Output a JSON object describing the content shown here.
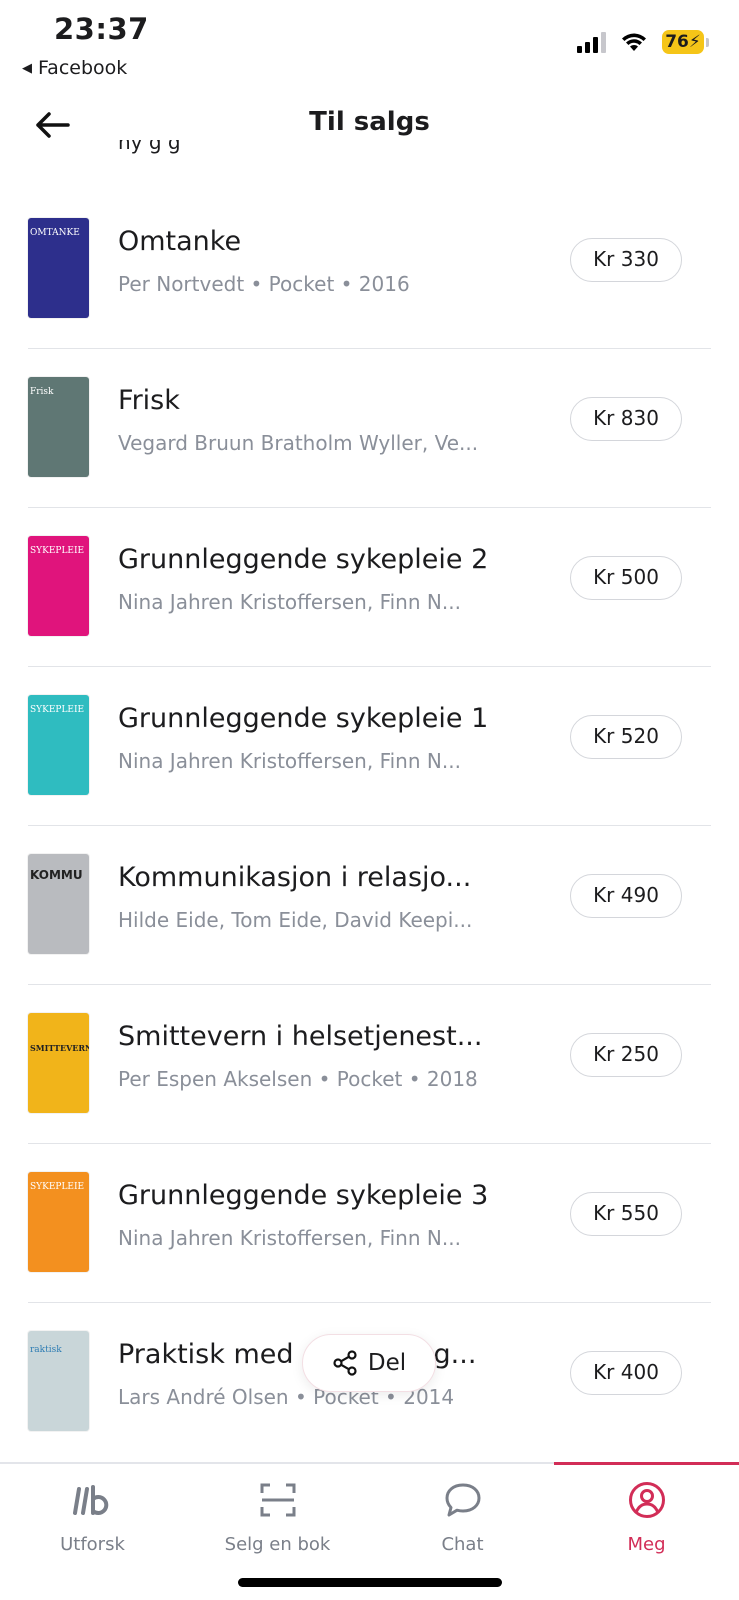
{
  "status_bar": {
    "time": "23:37",
    "back_app": "Facebook",
    "battery": "76"
  },
  "header": {
    "title": "Til salgs",
    "clipped_text": "ny g g"
  },
  "books": [
    {
      "title": "Omtanke",
      "subtitle": "Per Nortvedt • Pocket • 2016",
      "price": "Kr 330",
      "cover_color": "#2d2f8c",
      "cover_text": "OMTANKE"
    },
    {
      "title": "Frisk",
      "subtitle": "Vegard Bruun Bratholm Wyller, Ve...",
      "price": "Kr 830",
      "cover_color": "#5f7774",
      "cover_text": "Frisk"
    },
    {
      "title": "Grunnleggende sykepleie 2",
      "subtitle": "Nina Jahren Kristoffersen, Finn N...",
      "price": "Kr 500",
      "cover_color": "#e0147c",
      "cover_text": "SYKEPLEIE"
    },
    {
      "title": "Grunnleggende sykepleie 1",
      "subtitle": "Nina Jahren Kristoffersen, Finn N...",
      "price": "Kr 520",
      "cover_color": "#2fbcc0",
      "cover_text": "SYKEPLEIE"
    },
    {
      "title": "Kommunikasjon i relasjo...",
      "subtitle": "Hilde Eide, Tom Eide, David Keepi...",
      "price": "Kr 490",
      "cover_color": "#b9bbbf",
      "cover_text": "KOMMU"
    },
    {
      "title": "Smittevern i helsetjenest...",
      "subtitle": "Per Espen Akselsen • Pocket • 2018",
      "price": "Kr 250",
      "cover_color": "#f1b41a",
      "cover_text": "SMITTEVERN"
    },
    {
      "title": "Grunnleggende sykepleie 3",
      "subtitle": "Nina Jahren Kristoffersen, Finn N...",
      "price": "Kr 550",
      "cover_color": "#f3901f",
      "cover_text": "SYKEPLEIE"
    },
    {
      "title": "Praktisk med",
      "title_end": "g...",
      "subtitle": "Lars André Olsen • Pocket • 2014",
      "price": "Kr 400",
      "cover_color": "#c9d6d9",
      "cover_text": "raktisk"
    }
  ],
  "share": {
    "label": "Del"
  },
  "tabs": [
    {
      "label": "Utforsk",
      "icon": "library-icon"
    },
    {
      "label": "Selg en bok",
      "icon": "scan-icon"
    },
    {
      "label": "Chat",
      "icon": "chat-bubble-icon"
    },
    {
      "label": "Meg",
      "icon": "profile-icon",
      "active": true
    }
  ],
  "colors": {
    "accent": "#d22d57",
    "muted": "#8a8f99",
    "divider": "#e2e4e8"
  }
}
